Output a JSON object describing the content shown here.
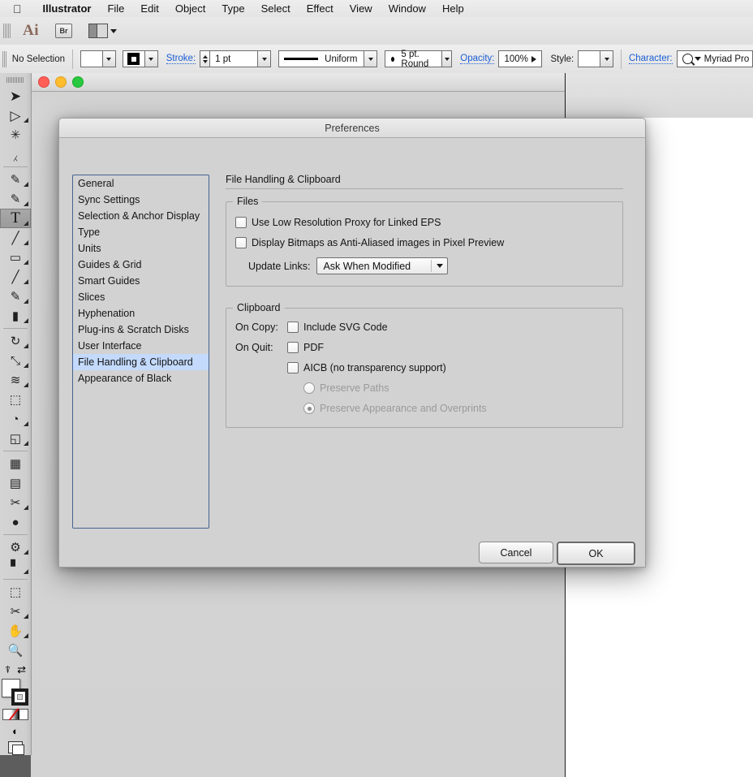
{
  "menubar": {
    "apple_icon": "apple-logo-icon",
    "items": [
      {
        "label": "Illustrator",
        "bold": true
      },
      {
        "label": "File"
      },
      {
        "label": "Edit"
      },
      {
        "label": "Object"
      },
      {
        "label": "Type"
      },
      {
        "label": "Select"
      },
      {
        "label": "Effect"
      },
      {
        "label": "View"
      },
      {
        "label": "Window"
      },
      {
        "label": "Help"
      }
    ]
  },
  "apptoolbar": {
    "app_logo": "Ai",
    "bridge_label": "Br",
    "arrange_documents_icon": "arrange-documents-icon"
  },
  "controlbar": {
    "selection_status": "No Selection",
    "stroke_label": "Stroke:",
    "stroke_weight": "1 pt",
    "profile_value": "Uniform",
    "brush_value": "5 pt. Round",
    "opacity_label": "Opacity:",
    "opacity_value": "100%",
    "style_label": "Style:",
    "character_label": "Character:",
    "character_value": "Myriad Pro"
  },
  "toolpanel": {
    "tools": [
      {
        "name": "selection-tool",
        "glyph": "⮝",
        "selected": false
      },
      {
        "name": "direct-selection-tool",
        "glyph": "⮝",
        "selected": false
      },
      {
        "name": "magic-wand-tool",
        "glyph": "✳",
        "selected": false
      },
      {
        "name": "lasso-tool",
        "glyph": "⊂",
        "selected": false
      },
      {
        "name": "pen-tool",
        "glyph": "✒",
        "selected": false
      },
      {
        "name": "add-anchor-point-tool",
        "glyph": "✒",
        "selected": false
      },
      {
        "name": "type-tool",
        "glyph": "T",
        "selected": true
      },
      {
        "name": "line-segment-tool",
        "glyph": "╱",
        "selected": false
      },
      {
        "name": "rectangle-tool",
        "glyph": "▭",
        "selected": false
      },
      {
        "name": "paintbrush-tool",
        "glyph": "╱",
        "selected": false
      },
      {
        "name": "pencil-tool",
        "glyph": "✎",
        "selected": false
      },
      {
        "name": "eraser-tool",
        "glyph": "▰",
        "selected": false
      },
      {
        "name": "rotate-tool",
        "glyph": "↻",
        "selected": false
      },
      {
        "name": "scale-tool",
        "glyph": "⤡",
        "selected": false
      },
      {
        "name": "width-tool",
        "glyph": "≋",
        "selected": false
      },
      {
        "name": "free-transform-tool",
        "glyph": "⬚",
        "selected": false
      },
      {
        "name": "shape-builder-tool",
        "glyph": "◔",
        "selected": false
      },
      {
        "name": "perspective-grid-tool",
        "glyph": "◱",
        "selected": false
      },
      {
        "name": "mesh-tool",
        "glyph": "▦",
        "selected": false
      },
      {
        "name": "gradient-tool",
        "glyph": "▤",
        "selected": false
      },
      {
        "name": "eyedropper-tool",
        "glyph": "✒",
        "selected": false
      },
      {
        "name": "blend-tool",
        "glyph": "●",
        "selected": false
      },
      {
        "name": "symbol-sprayer-tool",
        "glyph": "☂",
        "selected": false
      },
      {
        "name": "column-graph-tool",
        "glyph": "█",
        "selected": false
      },
      {
        "name": "artboard-tool",
        "glyph": "⬚",
        "selected": false
      },
      {
        "name": "slice-tool",
        "glyph": "✒",
        "selected": false
      },
      {
        "name": "hand-tool",
        "glyph": "✋",
        "selected": false
      },
      {
        "name": "zoom-tool",
        "glyph": "⚲",
        "selected": false
      }
    ],
    "fill_color": "#ffffff",
    "stroke_color": "#1c1c1c"
  },
  "document_window": {
    "traffic_lights": [
      "close-button",
      "minimize-button",
      "zoom-button"
    ],
    "close_color": "#ff5f57",
    "minimize_color": "#ffbd2e",
    "zoom_color": "#28c940"
  },
  "preferences": {
    "title": "Preferences",
    "categories": [
      {
        "label": "General",
        "active": false
      },
      {
        "label": "Sync Settings",
        "active": false
      },
      {
        "label": "Selection & Anchor Display",
        "active": false
      },
      {
        "label": "Type",
        "active": false
      },
      {
        "label": "Units",
        "active": false
      },
      {
        "label": "Guides & Grid",
        "active": false
      },
      {
        "label": "Smart Guides",
        "active": false
      },
      {
        "label": "Slices",
        "active": false
      },
      {
        "label": "Hyphenation",
        "active": false
      },
      {
        "label": "Plug-ins & Scratch Disks",
        "active": false
      },
      {
        "label": "User Interface",
        "active": false
      },
      {
        "label": "File Handling & Clipboard",
        "active": true
      },
      {
        "label": "Appearance of Black",
        "active": false
      }
    ],
    "pane_title": "File Handling & Clipboard",
    "files": {
      "legend": "Files",
      "low_res_proxy_label": "Use Low Resolution Proxy for Linked EPS",
      "low_res_proxy_checked": false,
      "anti_aliased_label": "Display Bitmaps as Anti-Aliased images in Pixel Preview",
      "anti_aliased_checked": false,
      "update_links_label": "Update Links:",
      "update_links_value": "Ask When Modified"
    },
    "clipboard": {
      "legend": "Clipboard",
      "on_copy_label": "On Copy:",
      "include_svg_label": "Include SVG Code",
      "include_svg_checked": false,
      "on_quit_label": "On Quit:",
      "pdf_label": "PDF",
      "pdf_checked": false,
      "aicb_label": "AICB (no transparency support)",
      "aicb_checked": false,
      "preserve_paths_label": "Preserve Paths",
      "preserve_paths_selected": false,
      "preserve_appearance_label": "Preserve Appearance and Overprints",
      "preserve_appearance_selected": true,
      "radios_disabled": true
    },
    "buttons": {
      "cancel": "Cancel",
      "ok": "OK"
    },
    "accent_selection_color": "#c3dafc",
    "list_border_color": "#45628f"
  }
}
